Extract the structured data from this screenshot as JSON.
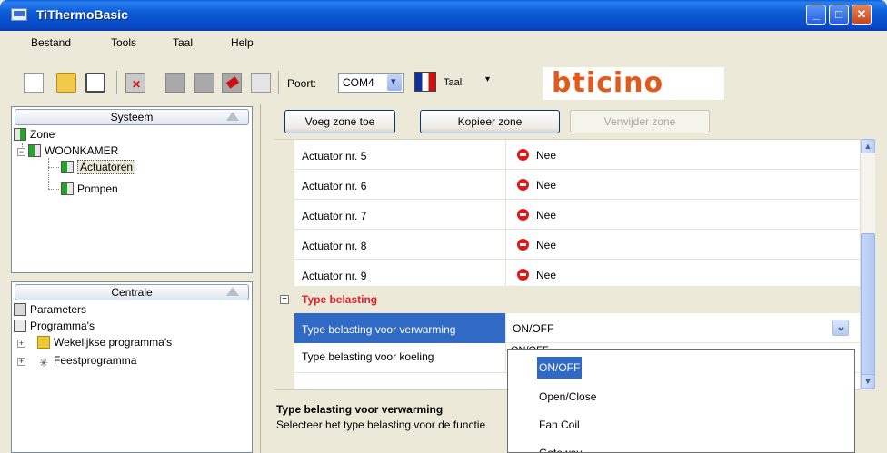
{
  "window": {
    "title": "TiThermoBasic",
    "minimize": "_",
    "maximize": "□",
    "close": "✕"
  },
  "menu": [
    "Bestand",
    "Tools",
    "Taal",
    "Help"
  ],
  "toolbar": {
    "port_label": "Poort:",
    "port_value": "COM4",
    "language_label": "Taal",
    "language_arrow": "▾",
    "logo": "bticino"
  },
  "systeem": {
    "header": "Systeem",
    "zone": "Zone",
    "woonkamer": "WOONKAMER",
    "actuatoren": "Actuatoren",
    "pompen": "Pompen"
  },
  "centrale": {
    "header": "Centrale",
    "parameters": "Parameters",
    "programmas": "Programma's",
    "wekelijkse": "Wekelijkse programma's",
    "feest": "Feestprogramma"
  },
  "buttons": {
    "add_zone": "Voeg zone toe",
    "copy_zone": "Kopieer zone",
    "delete_zone": "Verwijder zone"
  },
  "grid": {
    "actuators": [
      {
        "label": "Actuator nr. 5",
        "value": "Nee"
      },
      {
        "label": "Actuator nr. 6",
        "value": "Nee"
      },
      {
        "label": "Actuator nr. 7",
        "value": "Nee"
      },
      {
        "label": "Actuator nr. 8",
        "value": "Nee"
      },
      {
        "label": "Actuator nr. 9",
        "value": "Nee"
      }
    ],
    "section_title": "Type belasting",
    "section_toggle": "−",
    "heating_label": "Type belasting voor verwarming",
    "heating_value": "ON/OFF",
    "cooling_label": "Type belasting voor koeling",
    "cooling_value": "ON/OFF"
  },
  "dropdown_options": [
    "ON/OFF",
    "Open/Close",
    "Fan Coil",
    "Gateway"
  ],
  "help": {
    "title": "Type belasting voor verwarming",
    "description": "Selecteer het type belasting voor de functie"
  },
  "colors": {
    "selection": "#316ac5",
    "section_title": "#e0222b",
    "logo": "#e2591c"
  }
}
